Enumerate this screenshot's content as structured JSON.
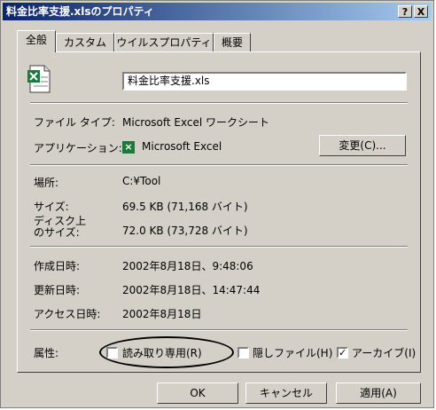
{
  "title": "料金比率支援.xlsのプロパティ",
  "title_buttons": {
    "help": "?",
    "close": "X"
  },
  "tabs": [
    "全般",
    "カスタム",
    "ウイルスプロパティ",
    "概要"
  ],
  "general": {
    "file_name": "料金比率支援.xls",
    "labels": {
      "file_type": "ファイル タイプ:",
      "application": "アプリケーション:",
      "location": "場所:",
      "size": "サイズ:",
      "disk_size_line1": "ディスク上",
      "disk_size_line2": "のサイズ:",
      "created": "作成日時:",
      "modified": "更新日時:",
      "accessed": "アクセス日時:",
      "attributes": "属性:"
    },
    "values": {
      "file_type": "Microsoft Excel ワークシート",
      "application": "Microsoft Excel",
      "location": "C:¥Tool",
      "size": "69.5 KB (71,168 バイト)",
      "disk_size": "72.0 KB (73,728 バイト)",
      "created": "2002年8月18日、9:48:06",
      "modified": "2002年8月18日、14:47:44",
      "accessed": "2002年8月18日"
    },
    "change_button": "変更(C)...",
    "attributes": {
      "readonly": {
        "label": "読み取り専用(R)",
        "checked": false
      },
      "hidden": {
        "label": "隠しファイル(H)",
        "checked": false
      },
      "archive": {
        "label": "アーカイブ(I)",
        "checked": true
      }
    },
    "check_mark": "✓"
  },
  "buttons": {
    "ok": "OK",
    "cancel": "キャンセル",
    "apply": "適用(A)"
  },
  "colors": {
    "dialog_bg": "#d4d0c8",
    "title_start": "#0a246a",
    "title_end": "#a6caf0",
    "excel_green": "#1b7a3a"
  }
}
